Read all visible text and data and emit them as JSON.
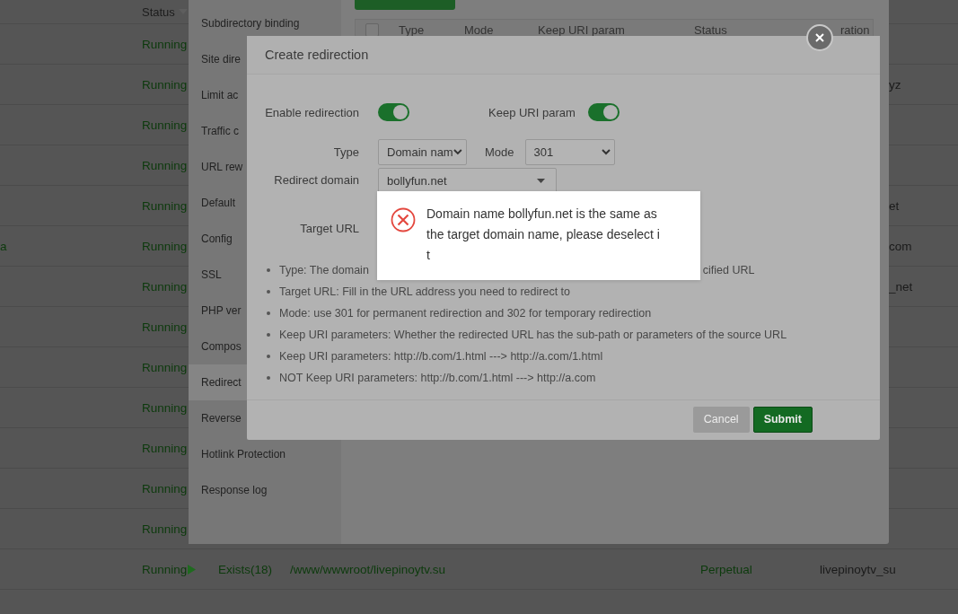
{
  "site_table": {
    "status_header": "Status",
    "rows": [
      {
        "left": "",
        "status": "Running",
        "play": false,
        "tail": ""
      },
      {
        "left": "",
        "status": "Running",
        "play": false,
        "tail": "yz"
      },
      {
        "left": "",
        "status": "Running",
        "play": false,
        "tail": ""
      },
      {
        "left": "",
        "status": "Running",
        "play": false,
        "tail": ""
      },
      {
        "left": "",
        "status": "Running",
        "play": false,
        "tail": "et"
      },
      {
        "left": "a",
        "status": "Running",
        "play": false,
        "tail": "com"
      },
      {
        "left": "",
        "status": "Running",
        "play": false,
        "tail": "_net"
      },
      {
        "left": "",
        "status": "Running",
        "play": false,
        "tail": ""
      },
      {
        "left": "",
        "status": "Running",
        "play": false,
        "tail": ""
      },
      {
        "left": "",
        "status": "Running",
        "play": false,
        "tail": ""
      },
      {
        "left": "",
        "status": "Running",
        "play": false,
        "tail": ""
      },
      {
        "left": "",
        "status": "Running",
        "play": false,
        "tail": ""
      },
      {
        "left": "",
        "status": "Running",
        "play": false,
        "tail": ""
      },
      {
        "left": "",
        "status": "Running",
        "play": true,
        "backup": "Exists(18)",
        "path": "/www/wwwroot/livepinoytv.su",
        "expiry": "Perpetual",
        "name": "livepinoytv_su"
      }
    ]
  },
  "settings_panel": {
    "menu": [
      {
        "label": "Subdirectory binding",
        "selected": false
      },
      {
        "label": "Site dire",
        "selected": false
      },
      {
        "label": "Limit ac",
        "selected": false
      },
      {
        "label": "Traffic c",
        "selected": false
      },
      {
        "label": "URL rew",
        "selected": false
      },
      {
        "label": "Default",
        "selected": false
      },
      {
        "label": "Config",
        "selected": false
      },
      {
        "label": "SSL",
        "selected": false
      },
      {
        "label": "PHP ver",
        "selected": false
      },
      {
        "label": "Compos",
        "selected": false
      },
      {
        "label": "Redirect",
        "selected": true
      },
      {
        "label": "Reverse",
        "selected": false
      },
      {
        "label": "Hotlink Protection",
        "selected": false
      },
      {
        "label": "Response log",
        "selected": false
      }
    ],
    "select_all": {
      "checked": false
    },
    "table_columns": [
      "Type",
      "Mode",
      "Keep URI param",
      "Status",
      "ration"
    ]
  },
  "dialog": {
    "title": "Create redirection",
    "enable_redirection": {
      "label": "Enable redirection",
      "on": true
    },
    "keep_uri": {
      "label": "Keep URI param",
      "on": true
    },
    "type": {
      "label": "Type",
      "value": "Domain nam"
    },
    "mode": {
      "label": "Mode",
      "value": "301"
    },
    "redirect_domain": {
      "label": "Redirect domain",
      "value": "bollyfun.net"
    },
    "target_url": {
      "label": "Target URL"
    },
    "notes": [
      {
        "parts": [
          "Type: The domain",
          "cified URL"
        ]
      },
      {
        "parts": [
          "Target URL: Fill in the URL address you need to redirect to"
        ]
      },
      {
        "parts": [
          "Mode: use 301 for permanent redirection and 302 for temporary redirection"
        ]
      },
      {
        "parts": [
          "Keep URI parameters: Whether the redirected URL has the sub-path or parameters of the source URL"
        ]
      },
      {
        "parts": [
          "Keep URI parameters: http://b.com/1.html ---> http://a.com/1.html"
        ]
      },
      {
        "parts": [
          "NOT Keep URI parameters: http://b.com/1.html ---> http://a.com"
        ]
      }
    ],
    "buttons": [
      {
        "label": "Cancel",
        "disabled": true
      },
      {
        "label": "Submit",
        "disabled": false
      }
    ]
  },
  "toast": {
    "kind": "error",
    "message": "Domain name bollyfun.net is the same as the target domain name, please deselect i t"
  }
}
